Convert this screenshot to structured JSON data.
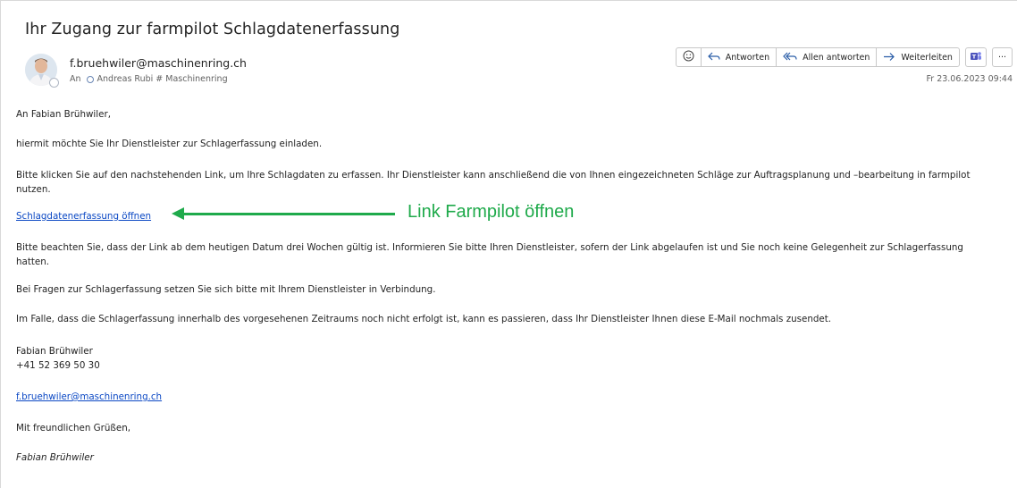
{
  "email": {
    "subject": "Ihr Zugang zur farmpilot Schlagdatenerfassung",
    "sender": "f.bruehwiler@maschinenring.ch",
    "to_prefix": "An",
    "to_name": "Andreas Rubi # Maschinenring",
    "date": "Fr 23.06.2023 09:44"
  },
  "toolbar": {
    "emoji_icon": "emoji-icon",
    "reply": "Antworten",
    "reply_all": "Allen antworten",
    "forward": "Weiterleiten",
    "teams_icon": "teams-icon",
    "more": "···"
  },
  "body": {
    "greeting": "An Fabian Brühwiler,",
    "p1": "hiermit möchte Sie Ihr Dienstleister zur Schlagerfassung einladen.",
    "p2": "Bitte klicken Sie auf den nachstehenden Link, um Ihre Schlagdaten zu erfassen. Ihr Dienstleister kann anschließend die von Ihnen eingezeichneten Schläge zur Auftragsplanung und –bearbeitung in farmpilot nutzen.",
    "link": "Schlagdatenerfassung öffnen",
    "p3": "Bitte beachten Sie, dass der Link ab dem heutigen Datum drei Wochen gültig ist. Informieren Sie bitte Ihren Dienstleister, sofern der Link abgelaufen ist und Sie noch keine Gelegenheit zur Schlagerfassung hatten.",
    "p4": "Bei Fragen zur Schlagerfassung setzen Sie sich bitte mit Ihrem Dienstleister in Verbindung.",
    "p5": "Im Falle, dass die Schlagerfassung innerhalb des vorgesehenen Zeitraums noch nicht erfolgt ist, kann es passieren, dass Ihr Dienstleister Ihnen diese E-Mail nochmals zusendet.",
    "sig_name": "Fabian Brühwiler",
    "sig_phone": "+41 52 369 50 30",
    "sig_email": "f.bruehwiler@maschinenring.ch",
    "closing": "Mit freundlichen Grüßen,",
    "sig_italic": "Fabian Brühwiler"
  },
  "annotation": {
    "label": "Link Farmpilot öffnen",
    "color": "#1faa4b"
  }
}
